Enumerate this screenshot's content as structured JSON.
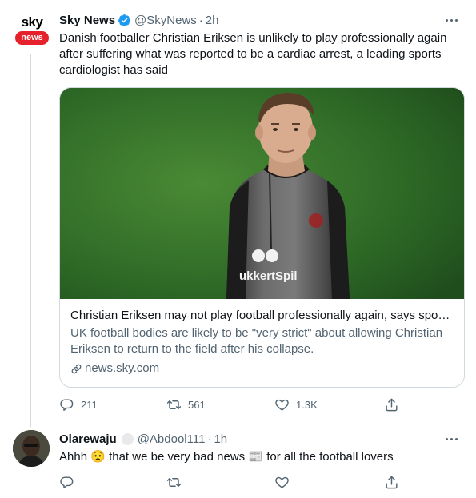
{
  "tweet": {
    "author_name": "Sky News",
    "handle": "@SkyNews",
    "separator": "·",
    "time": "2h",
    "avatar_text_top": "sky",
    "avatar_text_pill": "news",
    "text": "Danish footballer Christian Eriksen is unlikely to play professionally again after suffering what was reported to be a cardiac arrest, a leading sports cardiologist has said",
    "card": {
      "title": "Christian Eriksen may not play football professionally again, says sports...",
      "description": "UK football bodies are likely to be \"very strict\" about allowing Christian Eriksen to return to the field after his collapse.",
      "domain": "news.sky.com",
      "shirt_text": "ukkertSpil"
    },
    "actions": {
      "reply_count": "211",
      "retweet_count": "561",
      "like_count": "1.3K"
    }
  },
  "reply": {
    "author_name": "Olarewaju",
    "handle": "@Abdool111",
    "separator": "·",
    "time": "1h",
    "text_part1": "Ahhh",
    "emoji1": "😟",
    "text_part2": "that we be very bad news",
    "emoji2": "📰",
    "text_part3": "for all the football lovers"
  },
  "colors": {
    "accent": "#1d9bf0",
    "muted": "#536471",
    "text": "#0f1419",
    "sky_red": "#e5222b"
  }
}
